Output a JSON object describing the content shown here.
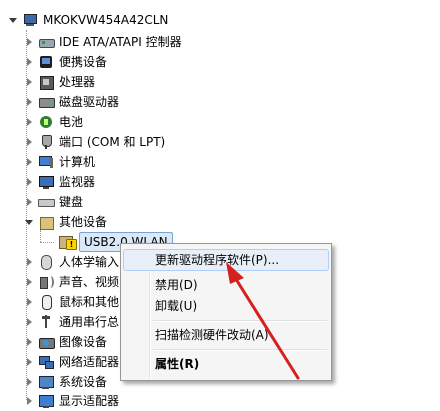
{
  "tree": {
    "root": {
      "label": "MKOKVW454A42CLN",
      "icon": "computer-icon"
    },
    "categories": [
      {
        "label": "IDE ATA/ATAPI 控制器",
        "icon": "ide-controller-icon"
      },
      {
        "label": "便携设备",
        "icon": "portable-device-icon"
      },
      {
        "label": "处理器",
        "icon": "processor-icon"
      },
      {
        "label": "磁盘驱动器",
        "icon": "disk-drive-icon"
      },
      {
        "label": "电池",
        "icon": "battery-icon"
      },
      {
        "label": "端口 (COM 和 LPT)",
        "icon": "port-icon"
      },
      {
        "label": "计算机",
        "icon": "computer-category-icon"
      },
      {
        "label": "监视器",
        "icon": "monitor-icon"
      },
      {
        "label": "键盘",
        "icon": "keyboard-icon"
      },
      {
        "label": "其他设备",
        "icon": "other-devices-icon"
      }
    ],
    "other_child": {
      "label": "USB2.0 WLAN",
      "icon": "warning-device-icon"
    },
    "categories_after": [
      {
        "label": "人体学输入",
        "icon": "hid-icon"
      },
      {
        "label": "声音、视频",
        "icon": "sound-video-icon"
      },
      {
        "label": "鼠标和其他",
        "icon": "mouse-icon"
      },
      {
        "label": "通用串行总",
        "icon": "usb-controller-icon"
      },
      {
        "label": "图像设备",
        "icon": "imaging-device-icon"
      },
      {
        "label": "网络适配器",
        "icon": "network-adapter-icon"
      },
      {
        "label": "系统设备",
        "icon": "system-device-icon"
      },
      {
        "label": "显示适配器",
        "icon": "display-adapter-icon"
      }
    ]
  },
  "context_menu": {
    "items": [
      {
        "label": "更新驱动程序软件(P)...",
        "highlighted": true
      },
      {
        "label": "禁用(D)"
      },
      {
        "label": "卸载(U)"
      },
      {
        "label": "扫描检测硬件改动(A)"
      },
      {
        "label": "属性(R)",
        "bold": true
      }
    ]
  },
  "colors": {
    "menu_background": "#f5f5f5",
    "menu_highlight": "#e8eff8",
    "selection": "#dbe8f7",
    "annotation_arrow": "#d62020"
  }
}
